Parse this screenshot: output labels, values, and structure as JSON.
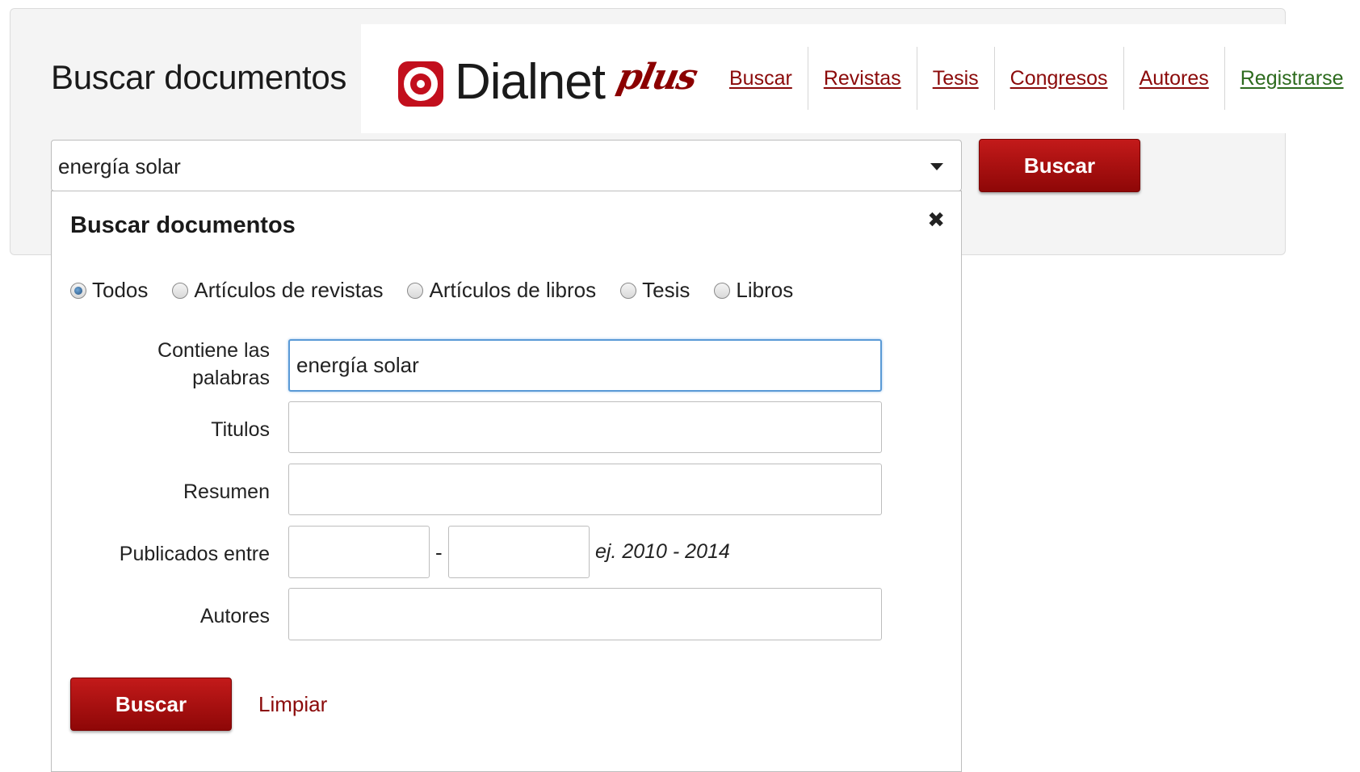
{
  "search_panel": {
    "title": "Buscar documentos",
    "query_value": "energía solar",
    "search_button": "Buscar"
  },
  "header": {
    "logo_text": "Dialnet",
    "logo_suffix": "plus",
    "nav": [
      {
        "label": "Buscar"
      },
      {
        "label": "Revistas"
      },
      {
        "label": "Tesis"
      },
      {
        "label": "Congresos"
      },
      {
        "label": "Autores"
      },
      {
        "label": "Registrarse"
      }
    ]
  },
  "advanced": {
    "title": "Buscar documentos",
    "close_icon": "close-icon",
    "doc_types": [
      {
        "label": "Todos",
        "checked": true
      },
      {
        "label": "Artículos de revistas",
        "checked": false
      },
      {
        "label": "Artículos de libros",
        "checked": false
      },
      {
        "label": "Tesis",
        "checked": false
      },
      {
        "label": "Libros",
        "checked": false
      }
    ],
    "fields": {
      "words_label_line1": "Contiene las",
      "words_label_line2": "palabras",
      "words_value": "energía solar",
      "titles_label": "Titulos",
      "titles_value": "",
      "abstract_label": "Resumen",
      "abstract_value": "",
      "published_label": "Publicados entre",
      "year_from": "",
      "year_separator": "-",
      "year_to": "",
      "year_hint": "ej. 2010 - 2014",
      "authors_label": "Autores",
      "authors_value": ""
    },
    "search_button": "Buscar",
    "clear_link": "Limpiar"
  },
  "colors": {
    "brand_red": "#8b0a0a",
    "button_red": "#b01010",
    "register_green": "#2d6b1e",
    "focus_blue": "#5a9ad6"
  }
}
